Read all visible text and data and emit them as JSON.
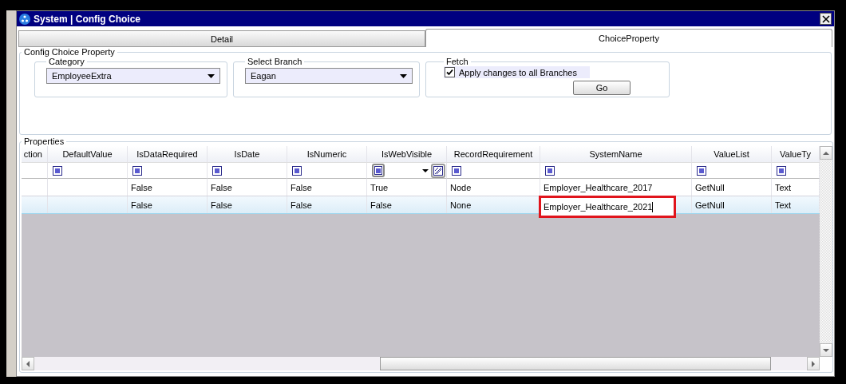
{
  "window": {
    "title": "System | Config Choice"
  },
  "tabs": [
    {
      "label": "Detail",
      "selected": false
    },
    {
      "label": "ChoiceProperty",
      "selected": true
    }
  ],
  "config_group": {
    "title": "Config Choice Property",
    "category": {
      "label": "Category",
      "value": "EmployeeExtra"
    },
    "branch": {
      "label": "Select Branch",
      "value": "Eagan"
    },
    "fetch": {
      "label": "Fetch",
      "checkbox": {
        "label": "Apply changes to all Branches",
        "checked": true
      },
      "button": "Go"
    }
  },
  "properties": {
    "title": "Properties",
    "columns": [
      {
        "label": "ction",
        "filter": false,
        "filter_open": false
      },
      {
        "label": "DefaultValue",
        "filter": true,
        "filter_open": false
      },
      {
        "label": "IsDataRequired",
        "filter": true,
        "filter_open": false
      },
      {
        "label": "IsDate",
        "filter": true,
        "filter_open": false
      },
      {
        "label": "IsNumeric",
        "filter": true,
        "filter_open": false
      },
      {
        "label": "IsWebVisible",
        "filter": true,
        "filter_open": true
      },
      {
        "label": "RecordRequirement",
        "filter": true,
        "filter_open": false
      },
      {
        "label": "SystemName",
        "filter": true,
        "filter_open": false
      },
      {
        "label": "ValueList",
        "filter": true,
        "filter_open": false
      },
      {
        "label": "ValueTy",
        "filter": true,
        "filter_open": false
      }
    ],
    "rows": [
      {
        "selected": false,
        "cells": [
          {
            "editing": false
          },
          {
            "editing": false
          },
          {
            "text": "False",
            "editing": false
          },
          {
            "text": "False",
            "editing": false
          },
          {
            "text": "False",
            "editing": false
          },
          {
            "text": "True",
            "editing": false
          },
          {
            "text": "Node",
            "editing": false
          },
          {
            "text": "Employer_Healthcare_2017",
            "editing": false
          },
          {
            "text": "GetNull",
            "editing": false
          },
          {
            "text": "Text",
            "editing": false
          }
        ]
      },
      {
        "selected": true,
        "cells": [
          {
            "editing": false
          },
          {
            "editing": false
          },
          {
            "text": "False",
            "editing": false
          },
          {
            "text": "False",
            "editing": false
          },
          {
            "text": "False",
            "editing": false
          },
          {
            "text": "False",
            "editing": false
          },
          {
            "text": "None",
            "editing": false
          },
          {
            "text": "Employer_Healthcare_2021",
            "editing": true
          },
          {
            "text": "GetNull",
            "editing": false
          },
          {
            "text": "Text",
            "editing": false
          }
        ]
      }
    ]
  }
}
